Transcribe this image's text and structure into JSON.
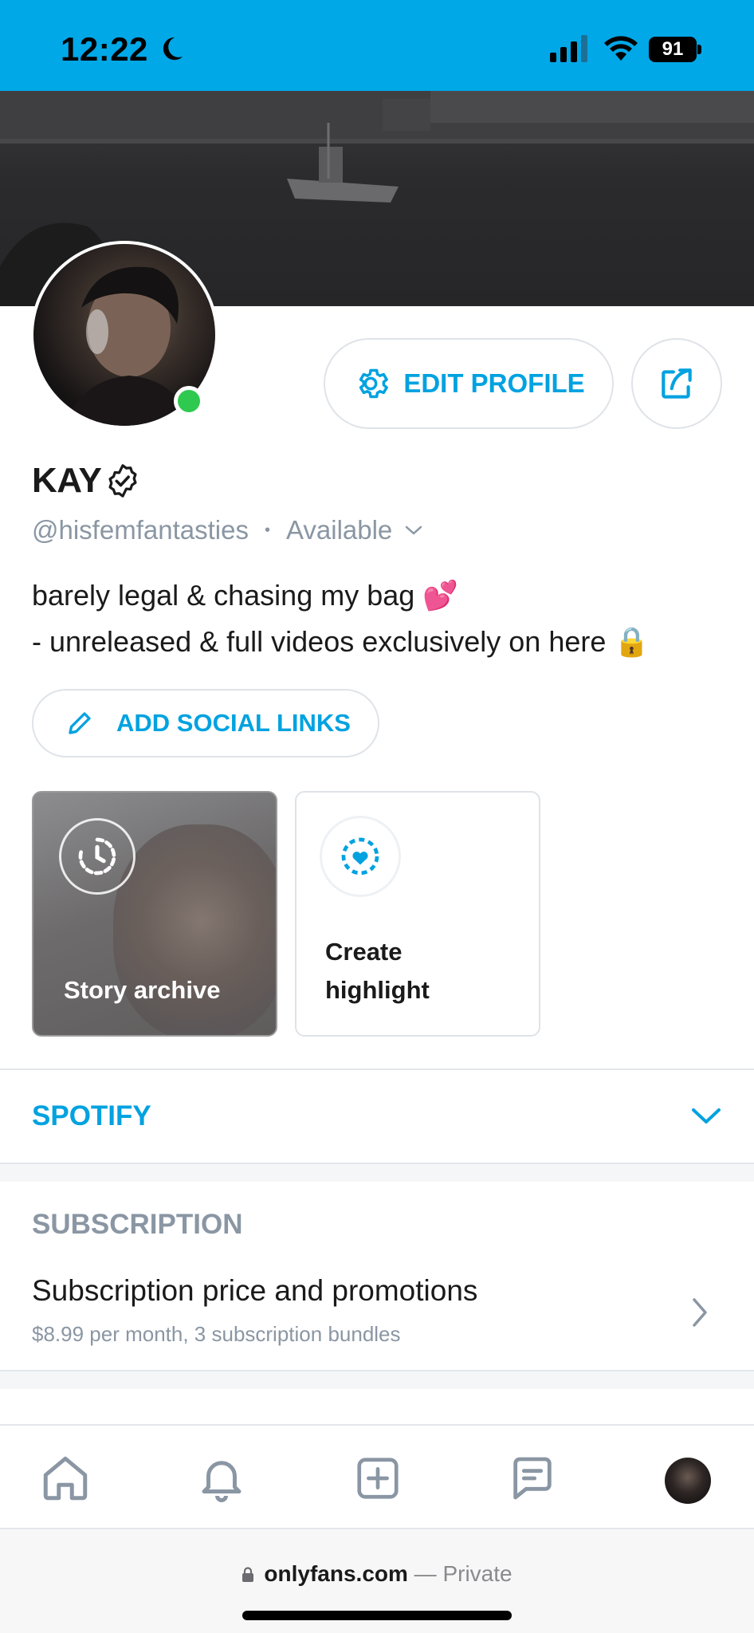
{
  "status_bar": {
    "time": "12:22",
    "battery": "91",
    "bg_color": "#00a8e8"
  },
  "profile": {
    "name": "KAY",
    "handle": "@hisfemfantasties",
    "availability": "Available",
    "bio_line1": "barely legal & chasing my bag 💕",
    "bio_line2": "- unreleased & full videos exclusively on here 🔒",
    "online": true
  },
  "buttons": {
    "edit_profile": "EDIT PROFILE",
    "add_social_links": "ADD SOCIAL LINKS"
  },
  "highlights": {
    "archive_label": "Story archive",
    "create_line1": "Create",
    "create_line2": "highlight"
  },
  "sections": {
    "spotify": "SPOTIFY",
    "subscription_header": "SUBSCRIPTION",
    "subscription_title": "Subscription price and promotions",
    "subscription_desc": "$8.99 per month, 3 subscription bundles"
  },
  "tabbar": {
    "icons": [
      "home-icon",
      "bell-icon",
      "plus-square-icon",
      "message-icon",
      "avatar"
    ]
  },
  "browser": {
    "host": "onlyfans.com",
    "suffix": " — Private"
  },
  "colors": {
    "accent": "#00a2e0",
    "muted": "#8a96a3",
    "online": "#2fc950"
  }
}
